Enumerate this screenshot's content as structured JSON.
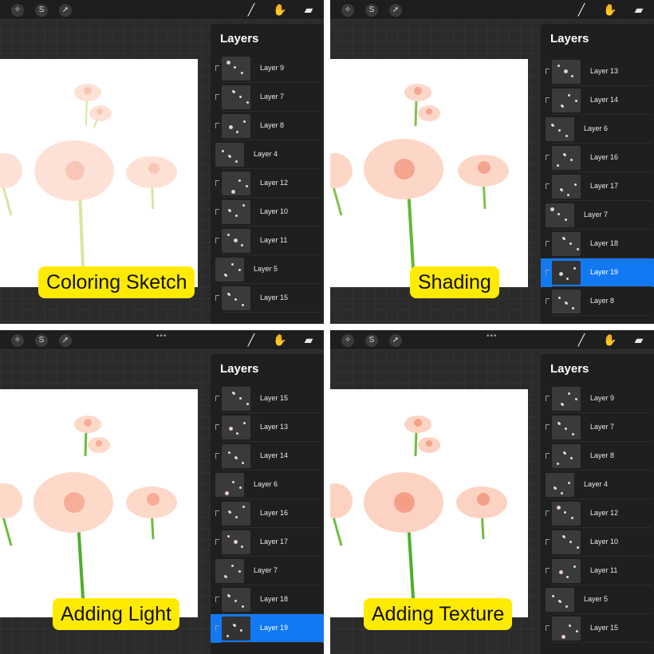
{
  "panels": [
    {
      "id": "coloring-sketch",
      "caption": "Coloring Sketch",
      "layers_title": "Layers",
      "layers": [
        {
          "name": "Layer 9",
          "clipped": true,
          "selected": false
        },
        {
          "name": "Layer 7",
          "clipped": true,
          "selected": false
        },
        {
          "name": "Layer 8",
          "clipped": true,
          "selected": false
        },
        {
          "name": "Layer 4",
          "clipped": false,
          "selected": false
        },
        {
          "name": "Layer 12",
          "clipped": true,
          "selected": false
        },
        {
          "name": "Layer 10",
          "clipped": true,
          "selected": false
        },
        {
          "name": "Layer 11",
          "clipped": true,
          "selected": false
        },
        {
          "name": "Layer 5",
          "clipped": false,
          "selected": false
        },
        {
          "name": "Layer 15",
          "clipped": true,
          "selected": false
        }
      ]
    },
    {
      "id": "shading",
      "caption": "Shading",
      "layers_title": "Layers",
      "layers": [
        {
          "name": "Layer 13",
          "clipped": true,
          "selected": false
        },
        {
          "name": "Layer 14",
          "clipped": true,
          "selected": false
        },
        {
          "name": "Layer 6",
          "clipped": false,
          "selected": false
        },
        {
          "name": "Layer 16",
          "clipped": true,
          "selected": false
        },
        {
          "name": "Layer 17",
          "clipped": true,
          "selected": false
        },
        {
          "name": "Layer 7",
          "clipped": false,
          "selected": false
        },
        {
          "name": "Layer 18",
          "clipped": true,
          "selected": false
        },
        {
          "name": "Layer 19",
          "clipped": true,
          "selected": true
        },
        {
          "name": "Layer 8",
          "clipped": true,
          "selected": false
        }
      ]
    },
    {
      "id": "adding-light",
      "caption": "Adding Light",
      "layers_title": "Layers",
      "layers": [
        {
          "name": "Layer 15",
          "clipped": true,
          "selected": false
        },
        {
          "name": "Layer 13",
          "clipped": true,
          "selected": false
        },
        {
          "name": "Layer 14",
          "clipped": true,
          "selected": false
        },
        {
          "name": "Layer 6",
          "clipped": false,
          "selected": false
        },
        {
          "name": "Layer 16",
          "clipped": true,
          "selected": false
        },
        {
          "name": "Layer 17",
          "clipped": true,
          "selected": false
        },
        {
          "name": "Layer 7",
          "clipped": false,
          "selected": false
        },
        {
          "name": "Layer 18",
          "clipped": true,
          "selected": false
        },
        {
          "name": "Layer 19",
          "clipped": true,
          "selected": true
        }
      ]
    },
    {
      "id": "adding-texture",
      "caption": "Adding Texture",
      "layers_title": "Layers",
      "layers": [
        {
          "name": "Layer 9",
          "clipped": true,
          "selected": false
        },
        {
          "name": "Layer 7",
          "clipped": true,
          "selected": false
        },
        {
          "name": "Layer 8",
          "clipped": true,
          "selected": false
        },
        {
          "name": "Layer 4",
          "clipped": false,
          "selected": false
        },
        {
          "name": "Layer 12",
          "clipped": true,
          "selected": false
        },
        {
          "name": "Layer 10",
          "clipped": true,
          "selected": false
        },
        {
          "name": "Layer 11",
          "clipped": true,
          "selected": false
        },
        {
          "name": "Layer 5",
          "clipped": false,
          "selected": false
        },
        {
          "name": "Layer 15",
          "clipped": true,
          "selected": false
        }
      ]
    }
  ],
  "toolbar": {
    "left_icons": [
      "adjustments-wand-icon",
      "selection-s-icon",
      "transform-arrow-icon"
    ],
    "right_icons": [
      "brush-icon",
      "smudge-icon",
      "eraser-icon"
    ]
  },
  "colors": {
    "caption_bg": "#ffeb00",
    "selected_layer": "#1279f3",
    "petal_flat": "#fde0d4",
    "petal_center": "#f8b9a8",
    "stem_sketch": "#d7e6a0",
    "stem_shaded": "#5fb83a"
  }
}
